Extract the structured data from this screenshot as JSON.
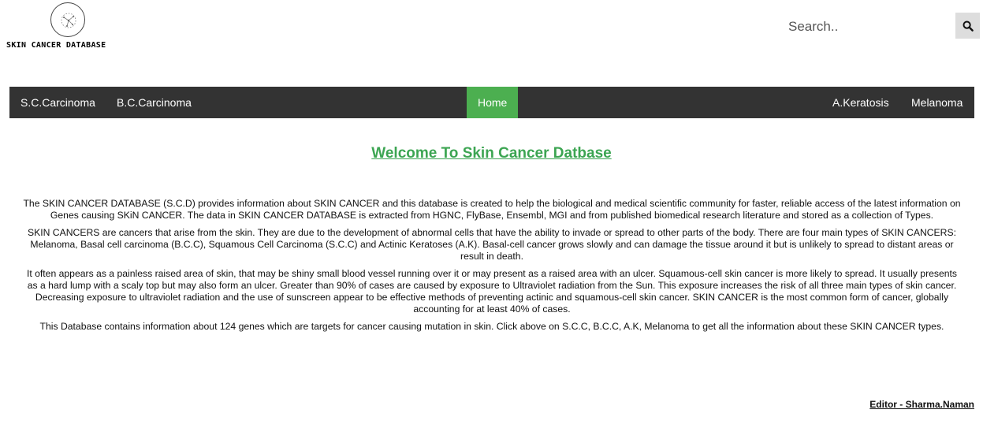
{
  "header": {
    "logo_text": "SKIN CANCER DATABASE",
    "search": {
      "placeholder": "Search.."
    }
  },
  "nav": {
    "left": [
      "S.C.Carcinoma",
      "B.C.Carcinoma"
    ],
    "center": "Home",
    "right": [
      "A.Keratosis",
      "Melanoma"
    ]
  },
  "main": {
    "title": "Welcome To Skin Cancer Datbase",
    "paragraphs": [
      "The SKIN CANCER DATABASE (S.C.D) provides information about SKIN CANCER and this database is created to help the biological and medical scientific community for faster, reliable access of the latest information on Genes causing SKiN CANCER. The data in SKIN CANCER DATABASE is extracted from HGNC, FlyBase, Ensembl, MGI and from published biomedical research literature and stored as a collection of Types.",
      "SKIN CANCERS are cancers that arise from the skin. They are due to the development of abnormal cells that have the ability to invade or spread to other parts of the body. There are four main types of SKIN CANCERS: Melanoma, Basal cell carcinoma (B.C.C), Squamous Cell Carcinoma (S.C.C) and Actinic Keratoses (A.K). Basal-cell cancer grows slowly and can damage the tissue around it but is unlikely to spread to distant areas or result in death.",
      "It often appears as a painless raised area of skin, that may be shiny small blood vessel running over it or may present as a raised area with an ulcer. Squamous-cell skin cancer is more likely to spread. It usually presents as a hard lump with a scaly top but may also form an ulcer. Greater than 90% of cases are caused by exposure to Ultraviolet radiation from the Sun. This exposure increases the risk of all three main types of skin cancer. Decreasing exposure to ultraviolet radiation and the use of sunscreen appear to be effective methods of preventing actinic and squamous-cell skin cancer. SKIN CANCER is the most common form of cancer, globally accounting for at least 40% of cases.",
      "This Database contains information about 124 genes which are targets for cancer causing mutation in skin. Click above on S.C.C, B.C.C, A.K, Melanoma to get all the information about these SKIN CANCER types."
    ]
  },
  "footer": {
    "editor": "Editor - Sharma.Naman"
  }
}
